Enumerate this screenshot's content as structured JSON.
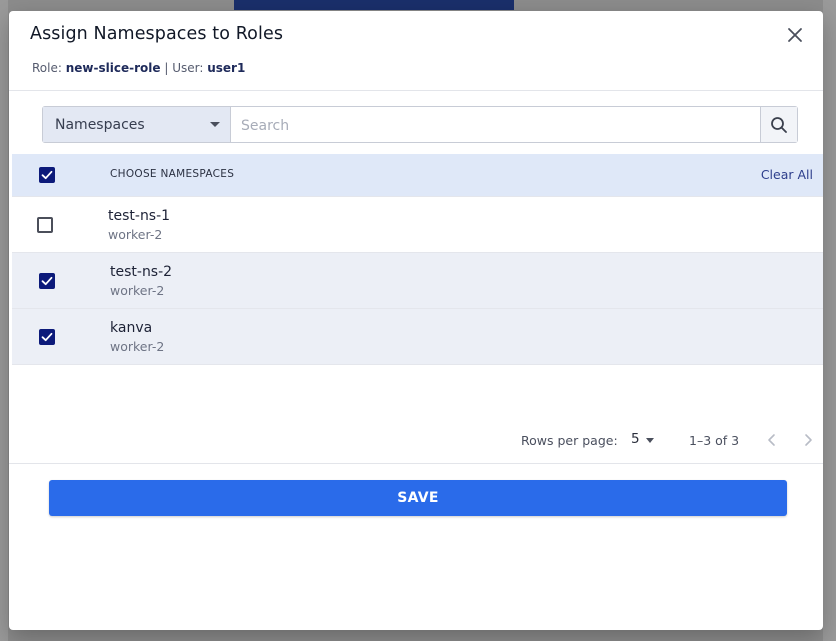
{
  "modal": {
    "title": "Assign Namespaces to Roles",
    "role_label": "Role:",
    "role_value": "new-slice-role",
    "separator": "|",
    "user_label": "User:",
    "user_value": "user1"
  },
  "search": {
    "filter_value": "Namespaces",
    "placeholder": "Search",
    "value": ""
  },
  "table": {
    "header": "CHOOSE NAMESPACES",
    "clear_all": "Clear All",
    "select_all_checked": true,
    "rows": [
      {
        "name": "test-ns-1",
        "worker": "worker-2",
        "checked": false
      },
      {
        "name": "test-ns-2",
        "worker": "worker-2",
        "checked": true
      },
      {
        "name": "kanva",
        "worker": "worker-2",
        "checked": true
      }
    ]
  },
  "pagination": {
    "rows_per_page_label": "Rows per page:",
    "rows_per_page": "5",
    "range": "1–3 of 3"
  },
  "actions": {
    "save_label": "SAVE"
  },
  "colors": {
    "primary": "#2a6bea",
    "checkbox": "#0c1a7a",
    "header_bg": "#dfe8f8"
  }
}
